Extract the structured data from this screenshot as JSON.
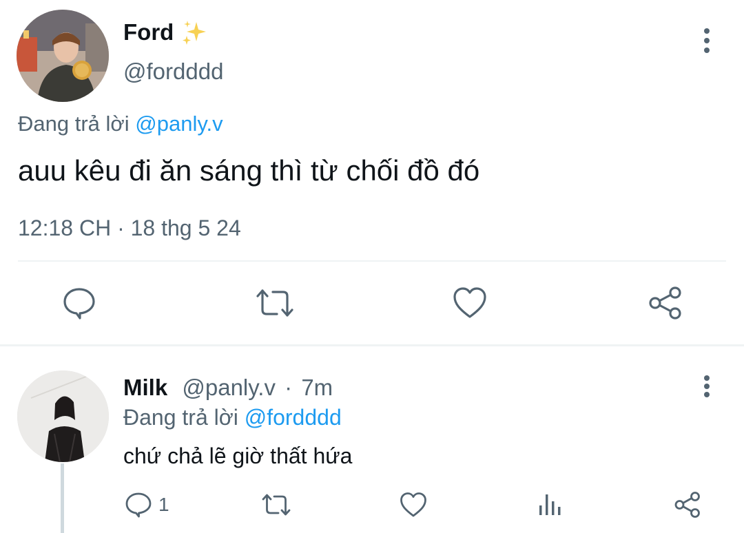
{
  "main_tweet": {
    "author_name": "Ford",
    "author_emoji": "✨",
    "handle": "@fordddd",
    "replying_prefix": "Đang trả lời",
    "replying_to": "@panly.v",
    "text": "auu kêu đi ăn sáng thì từ chối đồ đó",
    "timestamp": "12:18 CH · 18 thg 5 24",
    "actions": [
      "reply-icon",
      "retweet-icon",
      "like-icon",
      "share-icon"
    ]
  },
  "reply_tweet": {
    "author_name": "Milk",
    "handle": "@panly.v",
    "separator": "·",
    "time_ago": "7m",
    "replying_prefix": "Đang trả lời",
    "replying_to": "@fordddd",
    "text": "chứ chả lẽ giờ thất hứa",
    "reply_count": "1",
    "actions": [
      "reply-icon",
      "retweet-icon",
      "like-icon",
      "analytics-icon",
      "share-icon"
    ]
  },
  "colors": {
    "text_primary": "#0f1419",
    "text_secondary": "#536471",
    "link": "#1d9bf0",
    "divider": "#eff3f4",
    "icon": "#536471"
  }
}
